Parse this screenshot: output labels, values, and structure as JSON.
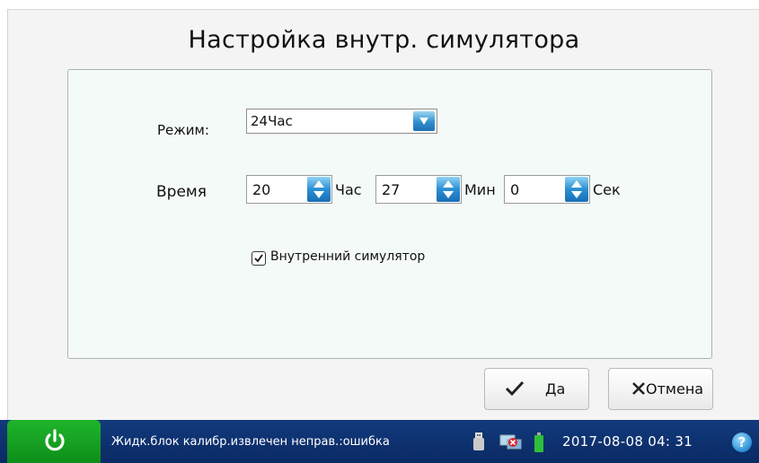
{
  "dialog": {
    "title": "Настройка внутр. симулятора"
  },
  "form": {
    "mode_label": "Режим:",
    "mode_value": "24Час",
    "time_label": "Время",
    "hours": {
      "value": "20",
      "unit": "Час"
    },
    "minutes": {
      "value": "27",
      "unit": "Мин"
    },
    "seconds": {
      "value": "0",
      "unit": "Сек"
    },
    "internal_simulator": {
      "label": "Внутренний симулятор",
      "checked": true
    }
  },
  "buttons": {
    "ok_label": "Да",
    "cancel_label": "Отмена"
  },
  "statusbar": {
    "message": "Жидк.блок калибр.извлечен неправ.:ошибка",
    "datetime": "2017-08-08  04: 31",
    "icons": [
      "usb-icon",
      "network-error-icon",
      "battery-icon",
      "help-icon"
    ],
    "help_glyph": "?"
  },
  "colors": {
    "statusbar_bg": "#0e2f6e",
    "power_button": "#16a323",
    "spinner_accent": "#2a8fd2"
  }
}
